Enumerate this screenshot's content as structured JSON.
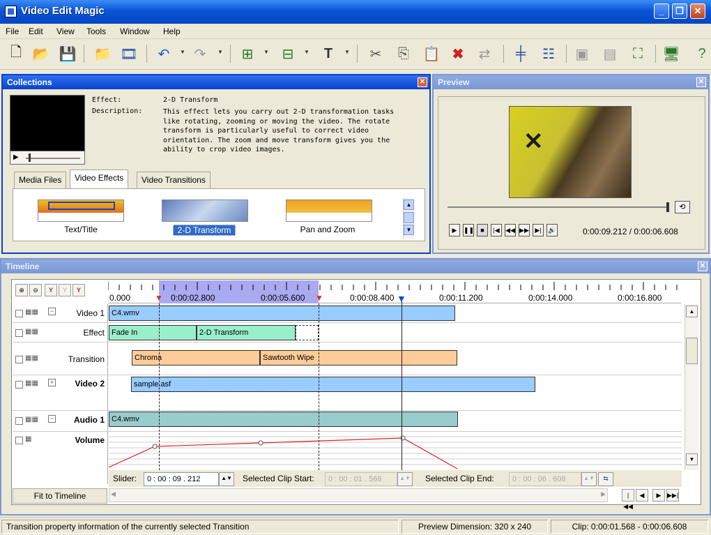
{
  "window": {
    "title": "Video Edit Magic"
  },
  "menu": [
    "File",
    "Edit",
    "View",
    "Tools",
    "Window",
    "Help"
  ],
  "collections": {
    "title": "Collections",
    "effect_label": "Effect:",
    "effect_value": "2-D Transform",
    "description_label": "Description:",
    "description_lines": [
      "This effect lets you carry out 2-D transformation tasks",
      "like rotating, zooming or moving the video. The rotate",
      "transform is particularly useful to correct video",
      "orientation. The zoom and move transform gives you the",
      "ability to crop video images."
    ],
    "tabs": [
      "Media Files",
      "Video Effects",
      "Video Transitions"
    ],
    "active_tab": "Video Effects",
    "items": [
      "Text/Title",
      "2-D Transform",
      "Pan and Zoom"
    ],
    "selected_item": "2-D Transform"
  },
  "preview": {
    "title": "Preview",
    "time_display": "0:00:09.212 / 0:00:06.608"
  },
  "timeline": {
    "title": "Timeline",
    "ruler_labels": [
      "0.000",
      "0:00:02.800",
      "0:00:05.600",
      "0:00:08.400",
      "0:00:11.200",
      "0:00:14.000",
      "0:00:16.800"
    ],
    "tracks": [
      {
        "name": "Video 1",
        "bold": false,
        "clips": [
          {
            "label": "C4.wmv"
          }
        ]
      },
      {
        "name": "Effect",
        "bold": false,
        "clips": [
          {
            "label": "Fade In"
          },
          {
            "label": "2-D Transform"
          }
        ]
      },
      {
        "name": "Transition",
        "bold": false,
        "clips": [
          {
            "label": "Chroma"
          },
          {
            "label": "Sawtooth Wipe"
          }
        ]
      },
      {
        "name": "Video 2",
        "bold": true,
        "clips": [
          {
            "label": "sample.asf"
          }
        ]
      },
      {
        "name": "Audio 1",
        "bold": true,
        "clips": [
          {
            "label": "C4.wmv"
          }
        ]
      },
      {
        "name": "Volume",
        "bold": true,
        "clips": []
      }
    ],
    "slider_label": "Slider:",
    "slider_value": "0 : 00 : 09 . 212",
    "clip_start_label": "Selected Clip Start:",
    "clip_start_value": "0 : 00 : 01 . 568",
    "clip_end_label": "Selected Clip End:",
    "clip_end_value": "0 : 00 : 06 . 608",
    "fit_button": "Fit to Timeline"
  },
  "status": {
    "message": "Transition property information of the currently selected Transition",
    "dimension": "Preview Dimension: 320 x 240",
    "clip": "Clip: 0:00:01.568 - 0:00:06.608"
  },
  "colors": {
    "title_bar": "#0a55d6",
    "panel_border": "#0a3fd6",
    "video_clip": "#99ccff",
    "effect_clip": "#99eecc",
    "transition_clip": "#ffcc99",
    "audio_clip": "#99cccc",
    "selection": "#aaaaf0",
    "volume_line": "#e02020"
  }
}
